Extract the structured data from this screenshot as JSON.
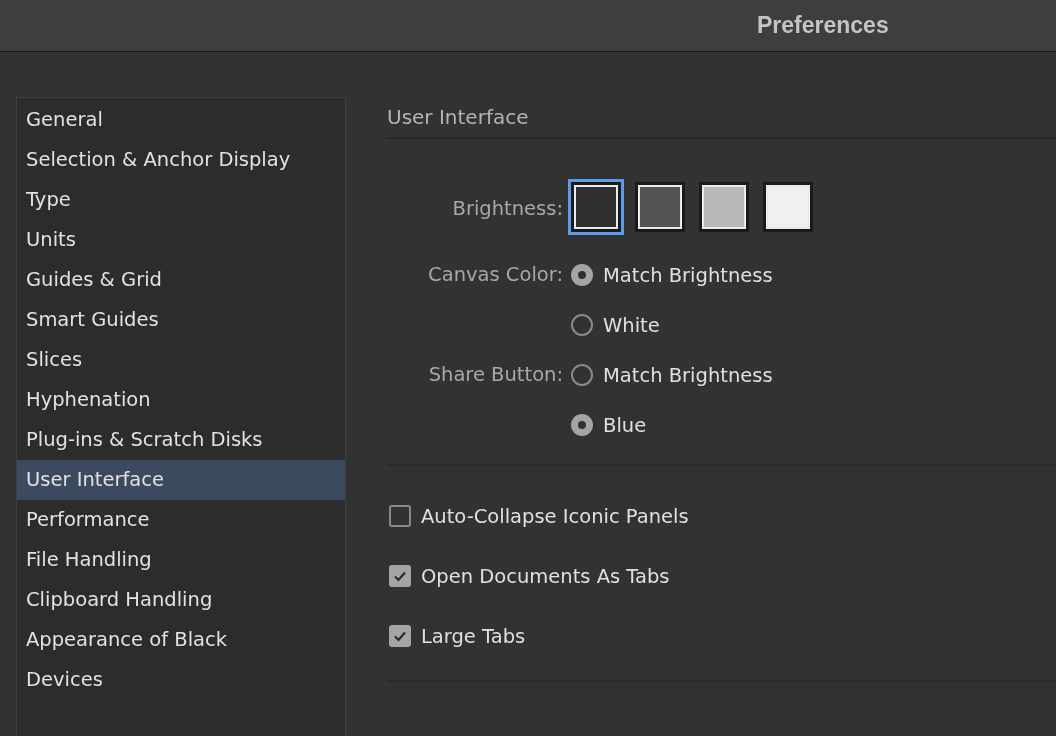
{
  "window": {
    "title": "Preferences"
  },
  "sidebar": {
    "items": [
      {
        "label": "General",
        "selected": false
      },
      {
        "label": "Selection & Anchor Display",
        "selected": false
      },
      {
        "label": "Type",
        "selected": false
      },
      {
        "label": "Units",
        "selected": false
      },
      {
        "label": "Guides & Grid",
        "selected": false
      },
      {
        "label": "Smart Guides",
        "selected": false
      },
      {
        "label": "Slices",
        "selected": false
      },
      {
        "label": "Hyphenation",
        "selected": false
      },
      {
        "label": "Plug-ins & Scratch Disks",
        "selected": false
      },
      {
        "label": "User Interface",
        "selected": true
      },
      {
        "label": "Performance",
        "selected": false
      },
      {
        "label": "File Handling",
        "selected": false
      },
      {
        "label": "Clipboard Handling",
        "selected": false
      },
      {
        "label": "Appearance of Black",
        "selected": false
      },
      {
        "label": "Devices",
        "selected": false
      }
    ]
  },
  "section_title": "User Interface",
  "brightness": {
    "label": "Brightness:",
    "swatches": [
      {
        "color": "#2f2f2f",
        "selected": true
      },
      {
        "color": "#535353",
        "selected": false
      },
      {
        "color": "#b8b8b8",
        "selected": false
      },
      {
        "color": "#f0f0f0",
        "selected": false
      }
    ]
  },
  "radio_groups": [
    {
      "label": "Canvas Color:",
      "options": [
        {
          "label": "Match Brightness",
          "selected": true
        },
        {
          "label": "White",
          "selected": false
        }
      ]
    },
    {
      "label": "Share Button:",
      "options": [
        {
          "label": "Match Brightness",
          "selected": false
        },
        {
          "label": "Blue",
          "selected": true
        }
      ]
    }
  ],
  "checkboxes": [
    {
      "label": "Auto-Collapse Iconic Panels",
      "checked": false
    },
    {
      "label": "Open Documents As Tabs",
      "checked": true
    },
    {
      "label": "Large Tabs",
      "checked": true
    }
  ]
}
